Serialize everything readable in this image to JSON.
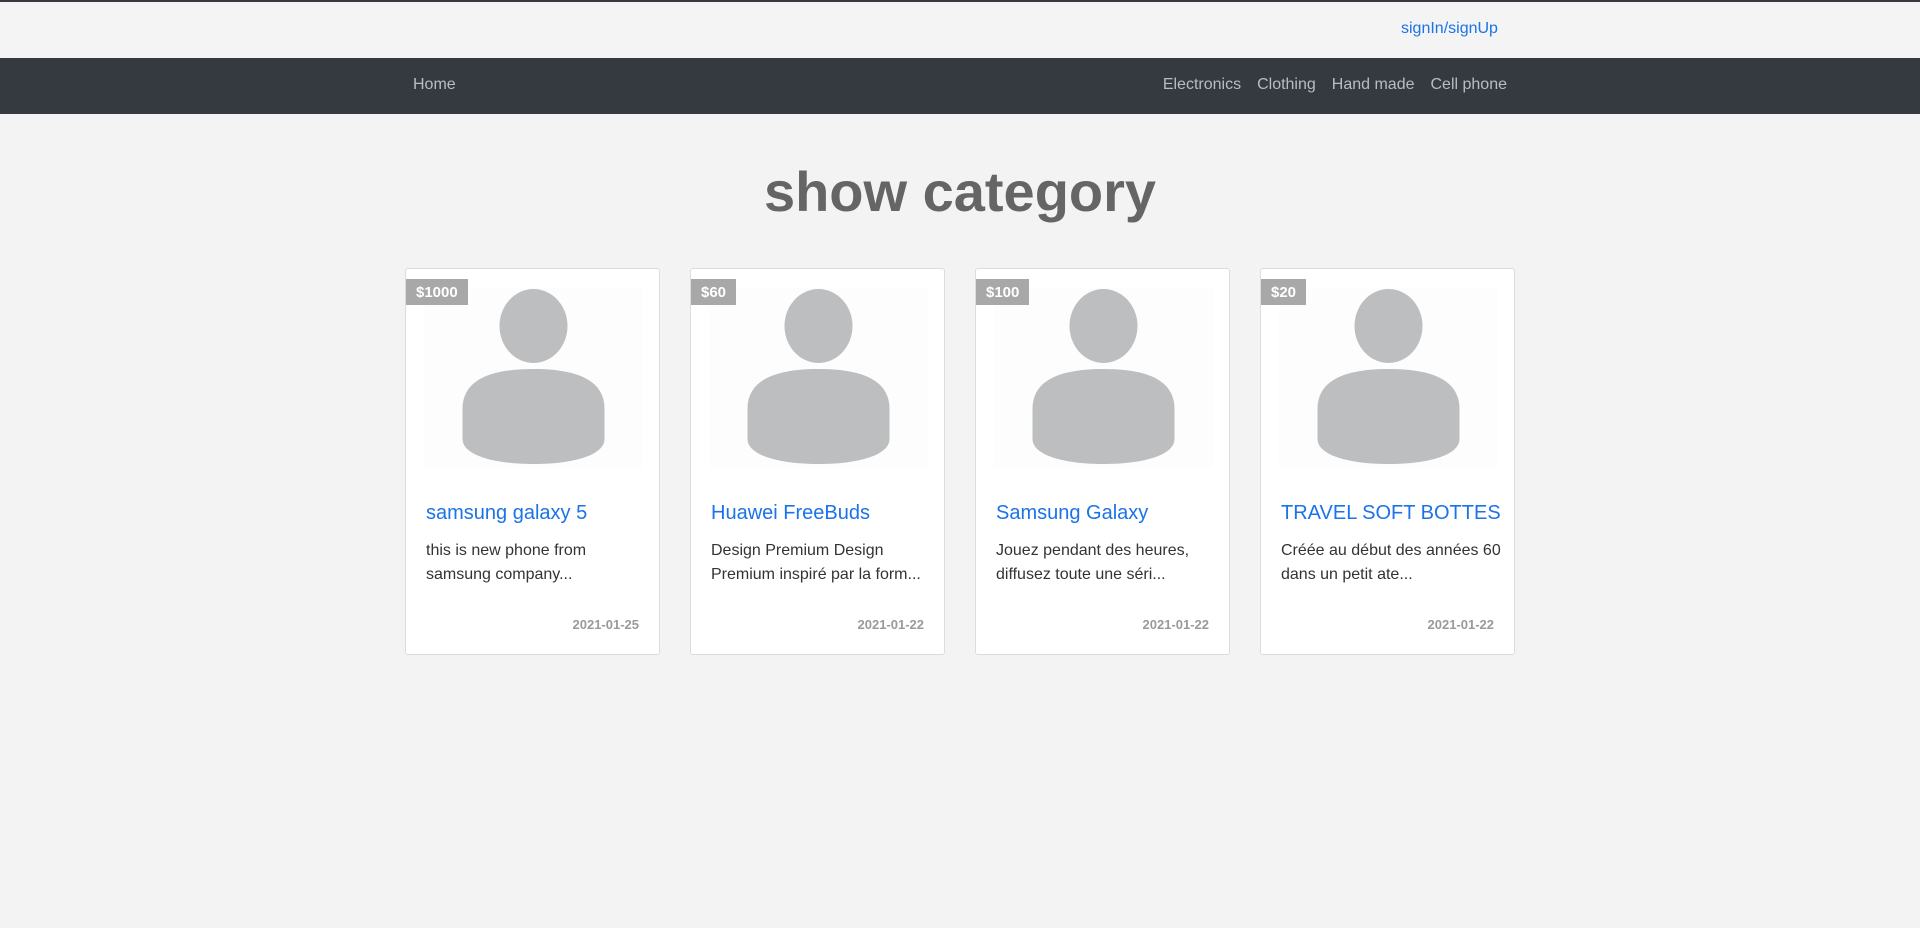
{
  "header": {
    "auth_link": "signIn/signUp"
  },
  "nav": {
    "home": "Home",
    "categories": [
      "Electronics",
      "Clothing",
      "Hand made",
      "Cell phone"
    ]
  },
  "main": {
    "title": "show category"
  },
  "products": [
    {
      "price": "$1000",
      "name": "samsung galaxy 5",
      "description": "this is new phone from samsung company...",
      "date": "2021-01-25",
      "image_icon": "user-placeholder-icon"
    },
    {
      "price": "$60",
      "name": "Huawei FreeBuds",
      "description": "Design Premium Design Premium inspiré par la form...",
      "date": "2021-01-22",
      "image_icon": "user-placeholder-icon"
    },
    {
      "price": "$100",
      "name": "Samsung Galaxy",
      "description": "Jouez pendant des heures, diffusez toute une séri...",
      "date": "2021-01-22",
      "image_icon": "user-placeholder-icon"
    },
    {
      "price": "$20",
      "name": "TRAVEL SOFT BOTTES",
      "description": "Créée au début des années 60 dans un petit ate...",
      "date": "2021-01-22",
      "image_icon": "user-placeholder-icon"
    }
  ],
  "colors": {
    "navbar": "#343a40",
    "link": "#1a73e8",
    "badge": "#a8a8a8",
    "background": "#f3f3f3"
  }
}
